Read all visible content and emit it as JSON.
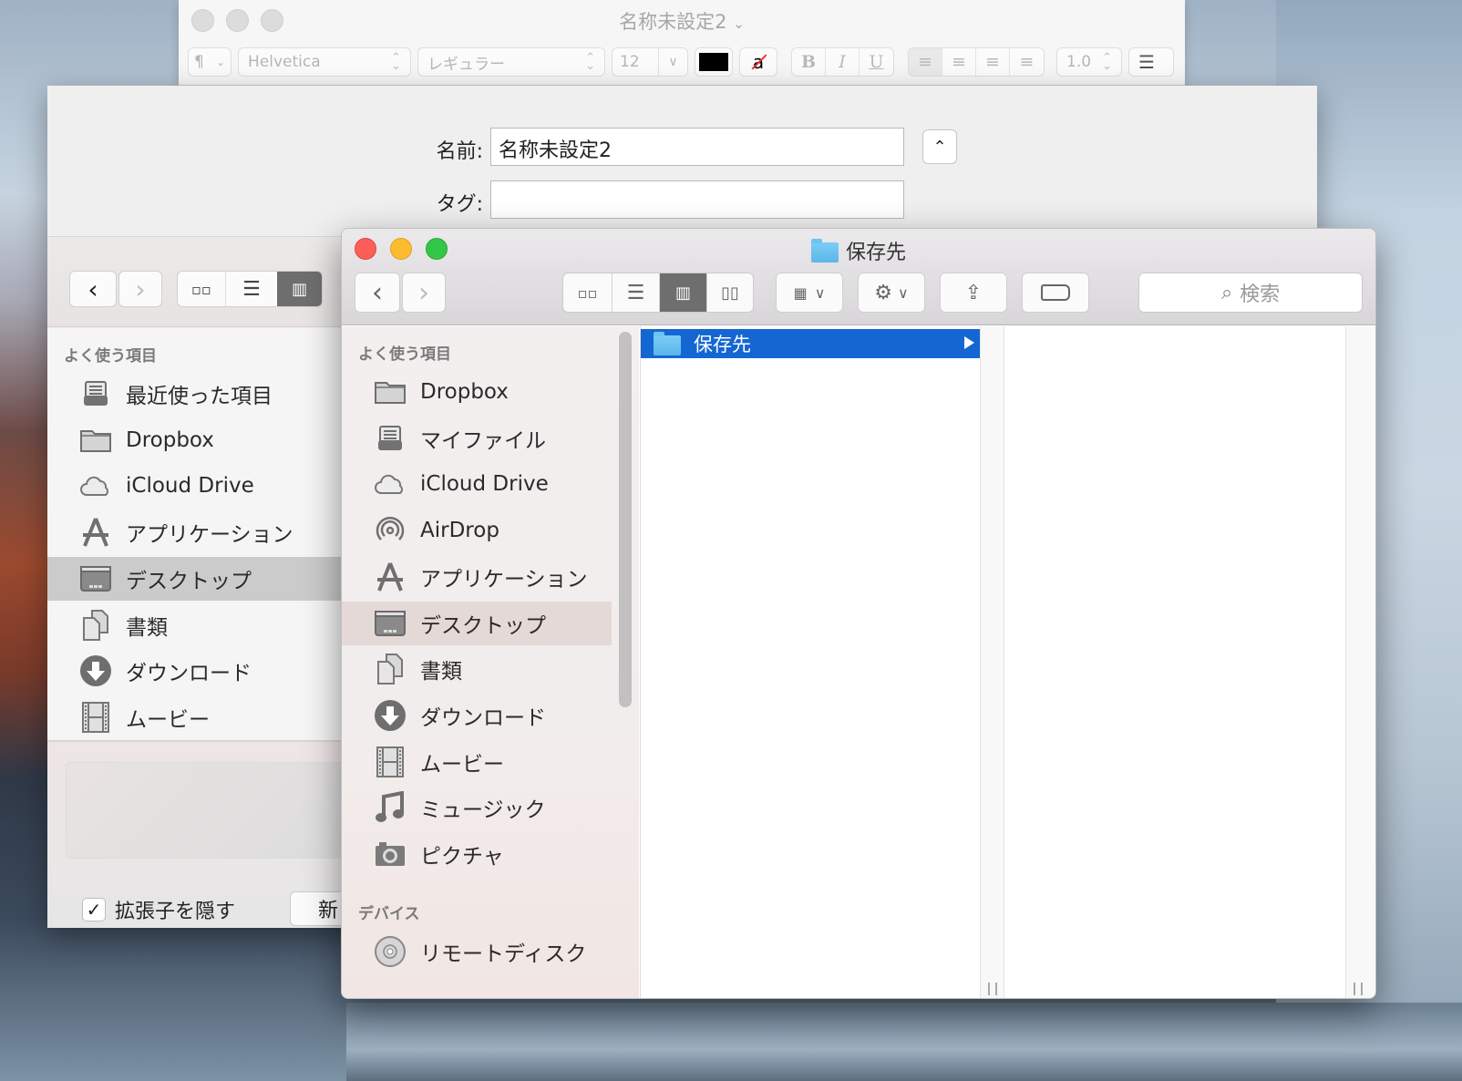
{
  "textedit": {
    "title": "名称未設定2",
    "title_chevron": "⌄",
    "paragraph_label": "¶",
    "font_family": "Helvetica",
    "font_style": "レギュラー",
    "font_size": "12",
    "text_color": "#000000",
    "highlight_label": "a",
    "bold": "B",
    "italic": "I",
    "underline": "U",
    "line_spacing": "1.0",
    "list_icon": "list-icon"
  },
  "save_sheet": {
    "name_label": "名前:",
    "name_value": "名称未設定2",
    "tags_label": "タグ:",
    "tags_value": "",
    "collapse_icon": "chevron-up-icon",
    "sidebar_heading": "よく使う項目",
    "sidebar_items": [
      {
        "label": "最近使った項目",
        "icon": "recents-icon"
      },
      {
        "label": "Dropbox",
        "icon": "folder-icon"
      },
      {
        "label": "iCloud Drive",
        "icon": "cloud-icon"
      },
      {
        "label": "アプリケーション",
        "icon": "applications-icon"
      },
      {
        "label": "デスクトップ",
        "icon": "desktop-icon",
        "selected": true
      },
      {
        "label": "書類",
        "icon": "documents-icon"
      },
      {
        "label": "ダウンロード",
        "icon": "download-icon"
      },
      {
        "label": "ムービー",
        "icon": "movies-icon"
      }
    ],
    "hide_extension_label": "拡張子を隠す",
    "hide_extension_checked": true,
    "new_folder_button": "新"
  },
  "finder": {
    "title": "保存先",
    "search_placeholder": "検索",
    "view_mode": "columns",
    "sidebar_heading_favorites": "よく使う項目",
    "favorites": [
      {
        "label": "Dropbox",
        "icon": "folder-icon"
      },
      {
        "label": "マイファイル",
        "icon": "all-my-files-icon"
      },
      {
        "label": "iCloud Drive",
        "icon": "cloud-icon"
      },
      {
        "label": "AirDrop",
        "icon": "airdrop-icon"
      },
      {
        "label": "アプリケーション",
        "icon": "applications-icon"
      },
      {
        "label": "デスクトップ",
        "icon": "desktop-icon",
        "selected": true
      },
      {
        "label": "書類",
        "icon": "documents-icon"
      },
      {
        "label": "ダウンロード",
        "icon": "download-icon"
      },
      {
        "label": "ムービー",
        "icon": "movies-icon"
      },
      {
        "label": "ミュージック",
        "icon": "music-icon"
      },
      {
        "label": "ピクチャ",
        "icon": "pictures-icon"
      }
    ],
    "sidebar_heading_devices": "デバイス",
    "devices": [
      {
        "label": "リモートディスク",
        "icon": "remote-disc-icon"
      }
    ],
    "column1_items": [
      {
        "label": "保存先",
        "selected": true,
        "has_children": true
      }
    ],
    "selection_color": "#1467d3"
  }
}
